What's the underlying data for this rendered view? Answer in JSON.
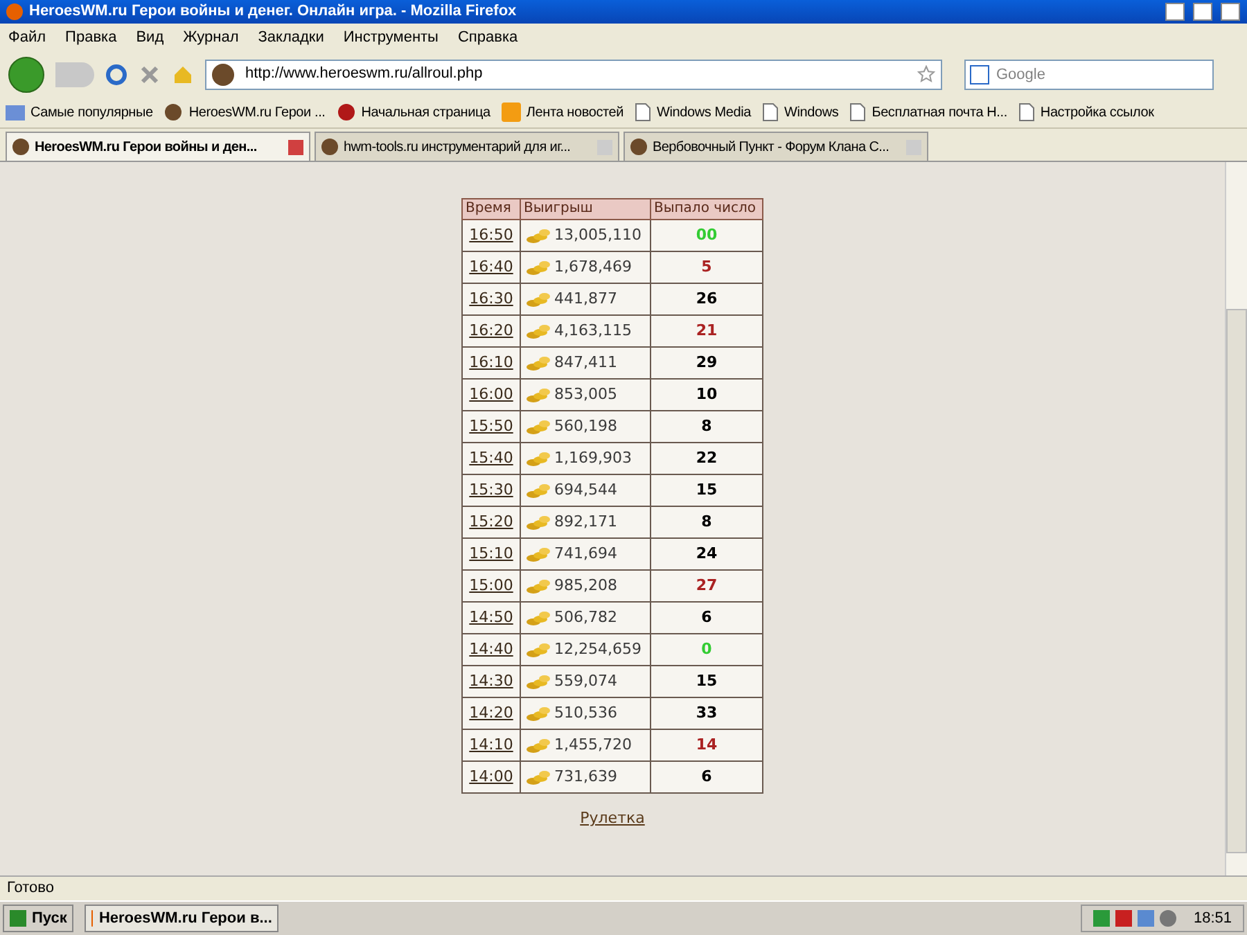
{
  "window": {
    "title": "HeroesWM.ru Герои войны и денег. Онлайн игра. - Mozilla Firefox"
  },
  "menu": [
    "Файл",
    "Правка",
    "Вид",
    "Журнал",
    "Закладки",
    "Инструменты",
    "Справка"
  ],
  "address": {
    "value": "http://www.heroeswm.ru/allroul.php"
  },
  "search": {
    "placeholder": "Google"
  },
  "bookmarks": [
    {
      "label": "Самые популярные",
      "kind": "smart"
    },
    {
      "label": "HeroesWM.ru Герои ...",
      "kind": "site"
    },
    {
      "label": "Начальная страница",
      "kind": "home"
    },
    {
      "label": "Лента новостей",
      "kind": "feed"
    },
    {
      "label": "Windows Media",
      "kind": "page"
    },
    {
      "label": "Windows",
      "kind": "page"
    },
    {
      "label": "Бесплатная почта Н...",
      "kind": "page"
    },
    {
      "label": "Настройка ссылок",
      "kind": "page"
    }
  ],
  "tabs": [
    {
      "label": "HeroesWM.ru Герои войны и ден...",
      "selected": true
    },
    {
      "label": "hwm-tools.ru инструментарий для иг...",
      "selected": false
    },
    {
      "label": "Вербовочный Пункт - Форум Клана С...",
      "selected": false
    }
  ],
  "table": {
    "columns": [
      "Время",
      "Выигрыш",
      "Выпало число"
    ],
    "rows": [
      {
        "time": "16:50",
        "win": "13,005,110",
        "number": "00",
        "color": "#33cc33"
      },
      {
        "time": "16:40",
        "win": "1,678,469",
        "number": "5",
        "color": "#aa2222"
      },
      {
        "time": "16:30",
        "win": "441,877",
        "number": "26",
        "color": "#000000"
      },
      {
        "time": "16:20",
        "win": "4,163,115",
        "number": "21",
        "color": "#aa2222"
      },
      {
        "time": "16:10",
        "win": "847,411",
        "number": "29",
        "color": "#000000"
      },
      {
        "time": "16:00",
        "win": "853,005",
        "number": "10",
        "color": "#000000"
      },
      {
        "time": "15:50",
        "win": "560,198",
        "number": "8",
        "color": "#000000"
      },
      {
        "time": "15:40",
        "win": "1,169,903",
        "number": "22",
        "color": "#000000"
      },
      {
        "time": "15:30",
        "win": "694,544",
        "number": "15",
        "color": "#000000"
      },
      {
        "time": "15:20",
        "win": "892,171",
        "number": "8",
        "color": "#000000"
      },
      {
        "time": "15:10",
        "win": "741,694",
        "number": "24",
        "color": "#000000"
      },
      {
        "time": "15:00",
        "win": "985,208",
        "number": "27",
        "color": "#aa2222"
      },
      {
        "time": "14:50",
        "win": "506,782",
        "number": "6",
        "color": "#000000"
      },
      {
        "time": "14:40",
        "win": "12,254,659",
        "number": "0",
        "color": "#33cc33"
      },
      {
        "time": "14:30",
        "win": "559,074",
        "number": "15",
        "color": "#000000"
      },
      {
        "time": "14:20",
        "win": "510,536",
        "number": "33",
        "color": "#000000"
      },
      {
        "time": "14:10",
        "win": "1,455,720",
        "number": "14",
        "color": "#aa2222"
      },
      {
        "time": "14:00",
        "win": "731,639",
        "number": "6",
        "color": "#000000"
      }
    ]
  },
  "link": "Рулетка",
  "status_bar": "Готово",
  "taskbar": {
    "start": "Пуск",
    "task": "HeroesWM.ru Герои в...",
    "clock": "18:51"
  }
}
